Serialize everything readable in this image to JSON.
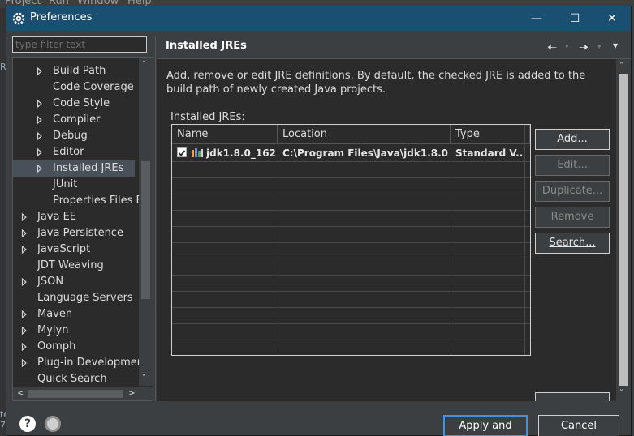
{
  "window": {
    "title": "Preferences",
    "minimize_glyph": "—",
    "maximize_glyph": "☐",
    "close_glyph": "✕"
  },
  "background": {
    "menu_items": [
      "Project",
      "Run",
      "Window",
      "Help"
    ],
    "left_labels": [
      "R",
      "te",
      "7"
    ]
  },
  "sidebar": {
    "filter_placeholder": "type filter text",
    "items": [
      {
        "label": "Build Path",
        "level": 1,
        "expandable": true
      },
      {
        "label": "Code Coverage",
        "level": 1,
        "expandable": false
      },
      {
        "label": "Code Style",
        "level": 1,
        "expandable": true
      },
      {
        "label": "Compiler",
        "level": 1,
        "expandable": true
      },
      {
        "label": "Debug",
        "level": 1,
        "expandable": true
      },
      {
        "label": "Editor",
        "level": 1,
        "expandable": true
      },
      {
        "label": "Installed JREs",
        "level": 1,
        "expandable": true,
        "selected": true
      },
      {
        "label": "JUnit",
        "level": 1,
        "expandable": false
      },
      {
        "label": "Properties Files Ed",
        "level": 1,
        "expandable": false
      },
      {
        "label": "Java EE",
        "level": 0,
        "expandable": true
      },
      {
        "label": "Java Persistence",
        "level": 0,
        "expandable": true
      },
      {
        "label": "JavaScript",
        "level": 0,
        "expandable": true
      },
      {
        "label": "JDT Weaving",
        "level": 0,
        "expandable": false
      },
      {
        "label": "JSON",
        "level": 0,
        "expandable": true
      },
      {
        "label": "Language Servers",
        "level": 0,
        "expandable": false
      },
      {
        "label": "Maven",
        "level": 0,
        "expandable": true
      },
      {
        "label": "Mylyn",
        "level": 0,
        "expandable": true
      },
      {
        "label": "Oomph",
        "level": 0,
        "expandable": true
      },
      {
        "label": "Plug-in Development",
        "level": 0,
        "expandable": true
      },
      {
        "label": "Quick Search",
        "level": 0,
        "expandable": false
      }
    ],
    "vscroll_up": "˄",
    "vscroll_down": "˅",
    "hscroll_left": "<",
    "hscroll_right": ">"
  },
  "page": {
    "title": "Installed JREs",
    "nav_back": "🠠",
    "nav_forward": "🠢",
    "nav_menu": "▾",
    "description": "Add, remove or edit JRE definitions. By default, the checked JRE is added to the build path of newly created Java projects.",
    "table_label": "Installed JREs:"
  },
  "jre_table": {
    "columns": [
      "Name",
      "Location",
      "Type"
    ],
    "rows": [
      {
        "checked": true,
        "name": "jdk1.8.0_162...",
        "location": "C:\\Program Files\\Java\\jdk1.8.0...",
        "type": "Standard V..."
      }
    ]
  },
  "buttons": {
    "add": "Add...",
    "edit": "Edit...",
    "duplicate": "Duplicate...",
    "remove": "Remove",
    "search": "Search..."
  },
  "footer": {
    "help_glyph": "?",
    "apply_close": "Apply and Close",
    "cancel": "Cancel"
  },
  "colors": {
    "titlebar": "#1b4f72",
    "panel": "#3c3f41",
    "content_bg": "#2b2b2b",
    "selection": "#48505a"
  }
}
